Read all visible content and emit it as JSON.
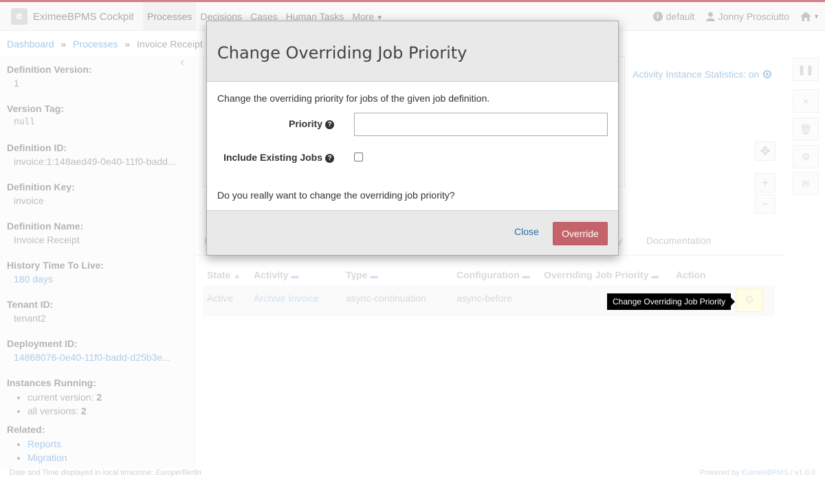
{
  "app": {
    "logo_letter": "e",
    "name": "EximeeBPMS Cockpit"
  },
  "nav": {
    "items": [
      "Processes",
      "Decisions",
      "Cases",
      "Human Tasks"
    ],
    "more": "More",
    "tenant": "default",
    "user": "Jonny Prosciutto"
  },
  "breadcrumb": {
    "dashboard": "Dashboard",
    "processes": "Processes",
    "current": "Invoice Receipt : R"
  },
  "sidebar": {
    "definition_version_label": "Definition Version:",
    "definition_version": "1",
    "version_tag_label": "Version Tag:",
    "version_tag": "null",
    "definition_id_label": "Definition ID:",
    "definition_id": "invoice:1:148aed49-0e40-11f0-badd...",
    "definition_key_label": "Definition Key:",
    "definition_key": "invoice",
    "definition_name_label": "Definition Name:",
    "definition_name": "Invoice Receipt",
    "history_ttl_label": "History Time To Live:",
    "history_ttl": "180 days",
    "tenant_id_label": "Tenant ID:",
    "tenant_id": "tenant2",
    "deployment_id_label": "Deployment ID:",
    "deployment_id": "14868076-0e40-11f0-badd-d25b3e...",
    "instances_running_label": "Instances Running:",
    "current_version_label": "current version:",
    "current_version_count": "2",
    "all_versions_label": "all versions:",
    "all_versions_count": "2",
    "related_label": "Related:",
    "related_links": [
      "Reports",
      "Migration"
    ]
  },
  "diagram": {
    "activity_stats": "Activity Instance Statistics: on"
  },
  "tabs": {
    "first_initial": "F",
    "partial": "y",
    "documentation": "Documentation"
  },
  "table": {
    "headers": [
      "State",
      "Activity",
      "Type",
      "Configuration",
      "Overriding Job Priority",
      "Action"
    ],
    "rows": [
      {
        "state": "Active",
        "activity": "Archive Invoice",
        "type": "async-continuation",
        "configuration": "async-before",
        "priority": ""
      }
    ]
  },
  "tooltip": "Change Overriding Job Priority",
  "modal": {
    "title": "Change Overriding Job Priority",
    "intro": "Change the overriding priority for jobs of the given job definition.",
    "priority_label": "Priority",
    "priority_value": "",
    "include_label": "Include Existing Jobs",
    "include_checked": false,
    "confirm_text": "Do you really want to change the overriding job priority?",
    "close_label": "Close",
    "override_label": "Override"
  },
  "footer": {
    "timezone_prefix": "Date and Time displayed in local timezone:",
    "timezone": "Europe/Berlin",
    "powered_by": "Powered by",
    "brand": "EximeeBPMS",
    "version": "/ v1.0.0"
  },
  "colors": {
    "accent": "#b5152b",
    "link": "#2d6ca8",
    "override_button": "#c5636a",
    "tooltip_bg": "#000000",
    "action_button": "#fffbcf"
  }
}
